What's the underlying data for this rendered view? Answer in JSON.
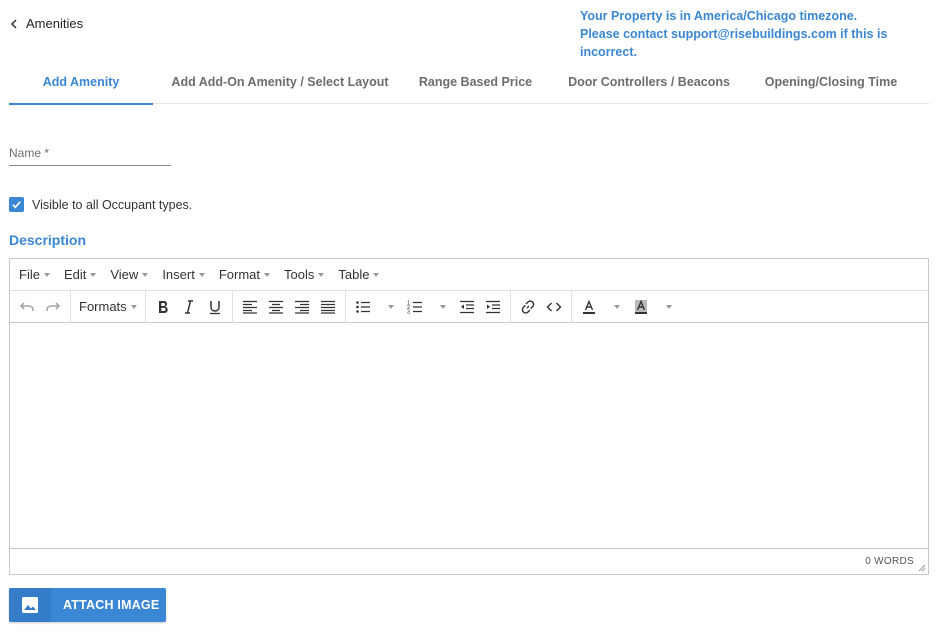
{
  "header": {
    "back_label": "Amenities",
    "timezone_line1": "Your Property is in America/Chicago timezone.",
    "timezone_line2": "Please contact support@risebuildings.com if this is incorrect."
  },
  "tabs": [
    {
      "label": "Add Amenity",
      "active": true
    },
    {
      "label": "Add Add-On Amenity / Select Layout",
      "active": false
    },
    {
      "label": "Range Based Price",
      "active": false
    },
    {
      "label": "Door Controllers / Beacons",
      "active": false
    },
    {
      "label": "Opening/Closing Time",
      "active": false
    }
  ],
  "form": {
    "name_label": "Name *",
    "name_value": "",
    "visible_checkbox_label": "Visible to all Occupant types.",
    "visible_checked": true,
    "description_title": "Description"
  },
  "editor": {
    "menu": [
      "File",
      "Edit",
      "View",
      "Insert",
      "Format",
      "Tools",
      "Table"
    ],
    "formats_label": "Formats",
    "word_count": "0 WORDS",
    "content": ""
  },
  "attach_button_label": "ATTACH IMAGE",
  "colors": {
    "accent": "#3a87d5",
    "text": "#333333",
    "tab_inactive": "#6d6d6d"
  }
}
